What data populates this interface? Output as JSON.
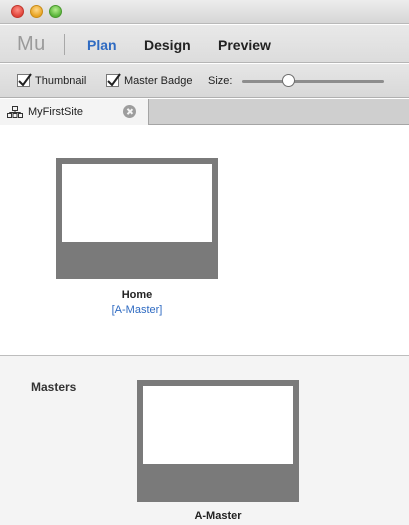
{
  "app": {
    "logo": "Mu"
  },
  "modes": [
    {
      "label": "Plan",
      "active": true
    },
    {
      "label": "Design",
      "active": false
    },
    {
      "label": "Preview",
      "active": false
    }
  ],
  "options": {
    "thumbnail": {
      "label": "Thumbnail",
      "checked": true
    },
    "master_badge": {
      "label": "Master Badge",
      "checked": true
    },
    "size": {
      "label": "Size:",
      "value_fraction": 0.32
    }
  },
  "tab": {
    "label": "MyFirstSite",
    "icon": "sitemap-icon"
  },
  "pages": [
    {
      "name": "Home",
      "master": "[A-Master]"
    }
  ],
  "masters": {
    "heading": "Masters",
    "items": [
      {
        "name": "A-Master"
      }
    ]
  },
  "colors": {
    "accent": "#2f6bc2",
    "thumb_frame": "#7a7a7a"
  }
}
